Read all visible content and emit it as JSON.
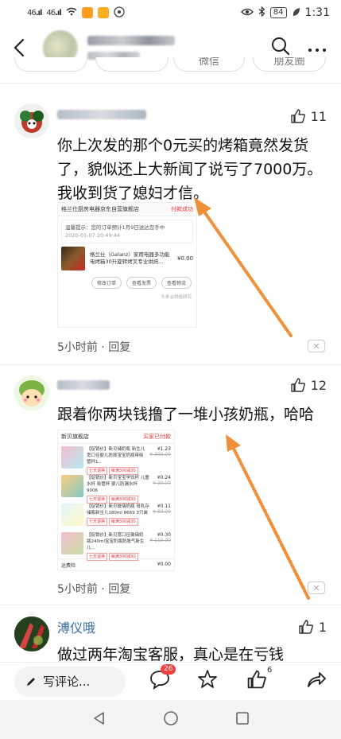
{
  "status_bar": {
    "signal1": "46",
    "signal2": "46",
    "battery": "84",
    "time": "1:31"
  },
  "header": {
    "back_icon": "chevron-left-icon",
    "search_icon": "search-icon",
    "more_icon": "more-icon"
  },
  "share_chips": [
    "微信",
    "朋友圈"
  ],
  "comments": [
    {
      "likes": "11",
      "text": "你上次发的那个0元买的烤箱竟然发货了，貌似还上大新闻了说亏了7000万。我收到货了媳妇才信。",
      "meta_time": "5小时前",
      "meta_reply": "· 回复",
      "order": {
        "store": "格兰仕厨房电器京东自营旗舰店",
        "status": "付款成功",
        "notice_line1": "温馨提示：您的订单预计1月9日送达您手中",
        "notice_line2": "2020-01-07 20:49:44",
        "product_title": "格兰仕（Galanz）家用电器多功能电烤箱30升旋转烤叉专业烘焙...",
        "price": "¥0.00",
        "btn1": "修改订单",
        "btn2": "查看发票",
        "btn3": "查看物流",
        "footer": "头条@烘焙研究"
      }
    },
    {
      "likes": "12",
      "text": "跟着你两块钱撸了一堆小孩奶瓶，哈哈",
      "meta_time": "5小时前",
      "meta_reply": "· 回复",
      "order": {
        "store": "新贝旗舰店",
        "status": "买家已付款",
        "items": [
          {
            "title": "【促销价】新贝储奶瓶 新生儿宽口径婴儿防摔宝宝奶瓶带吸管杯1...",
            "tag": "七天退换",
            "tag2": "每满300减30",
            "price": "¥1.23",
            "orig": "¥ 300.00"
          },
          {
            "title": "【促销价】新贝宝宝学饮杯 儿童水杯 吸管杯 婴儿防漏水杯 9006",
            "tag": "七天退换",
            "tag2": "每满300减30",
            "price": "¥0.24",
            "orig": "¥ 39.00"
          },
          {
            "title": "【促销价】新贝玻璃奶瓶 母乳存储瓶新生儿180ml 8669 3只装",
            "tag": "七天退换",
            "tag2": "每满300减30",
            "price": "¥0.11",
            "orig": "¥ 89.00"
          },
          {
            "title": "【促销价】新贝宽口径玻璃奶瓶240ml宝宝奶瓶防胀气新生儿...",
            "tag": "七天退换",
            "tag2": "每满300减30",
            "price": "¥0.30",
            "orig": "¥ 119.00"
          }
        ],
        "shipping": "运费险",
        "shipping_price": "¥0.00"
      }
    },
    {
      "name": "溥仪哦",
      "likes": "1",
      "text": "做过两年淘宝客服，真心是在亏钱"
    }
  ],
  "action_bar": {
    "write_placeholder": "写评论...",
    "comment_count": "26",
    "like_count": "6"
  },
  "colors": {
    "accent_orange": "#f0913a",
    "badge_red": "#f04142",
    "name_blue": "#3a6ea5"
  }
}
